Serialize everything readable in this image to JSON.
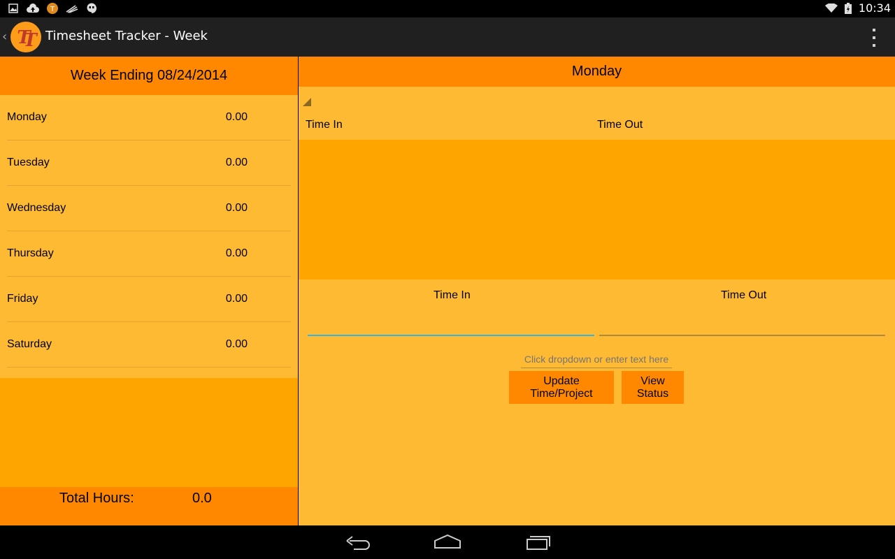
{
  "status_bar": {
    "time": "10:34",
    "left_icons": [
      "image-icon",
      "cloud-upload-icon",
      "timesheet-app-icon",
      "sync-icon",
      "hangouts-icon"
    ],
    "right_icons": [
      "wifi-icon",
      "battery-charging-icon"
    ]
  },
  "action_bar": {
    "title": "Timesheet Tracker - Week",
    "logo_text": "TT"
  },
  "week": {
    "header": "Week Ending 08/24/2014",
    "days": [
      {
        "name": "Monday",
        "hours": "0.00"
      },
      {
        "name": "Tuesday",
        "hours": "0.00"
      },
      {
        "name": "Wednesday",
        "hours": "0.00"
      },
      {
        "name": "Thursday",
        "hours": "0.00"
      },
      {
        "name": "Friday",
        "hours": "0.00"
      },
      {
        "name": "Saturday",
        "hours": "0.00"
      }
    ],
    "total_label": "Total Hours:",
    "total_value": "0.0"
  },
  "detail": {
    "day_title": "Monday",
    "list_headers": {
      "time_in": "Time In",
      "time_out": "Time Out"
    },
    "entry_labels": {
      "time_in": "Time In",
      "time_out": "Time Out"
    },
    "time_in_value": "",
    "time_out_value": "",
    "project_placeholder": "Click dropdown or enter text here",
    "update_button": "Update Time/Project",
    "status_button": "View Status"
  },
  "colors": {
    "header_orange": "#ff8800",
    "panel_yellow": "#ffba33",
    "fill_orange": "#ffa500",
    "focus_blue": "#33b5e5"
  }
}
